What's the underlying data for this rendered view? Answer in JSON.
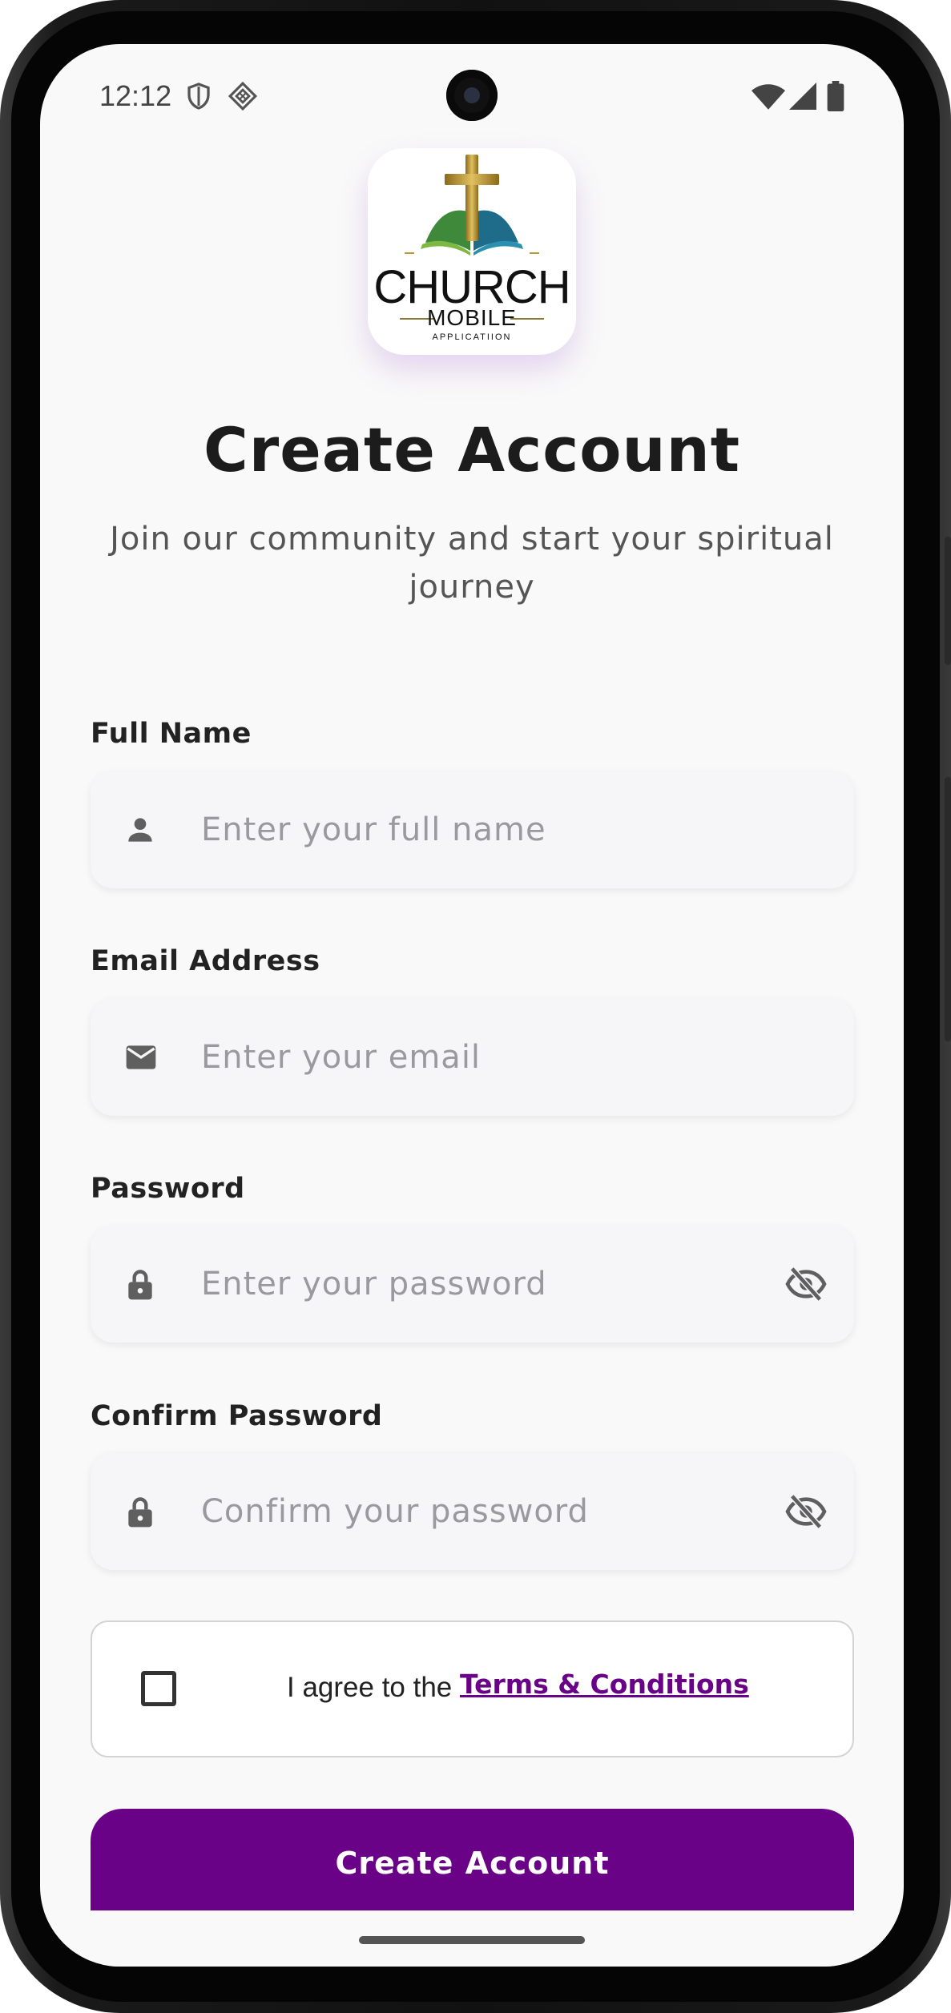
{
  "status_bar": {
    "time": "12:12"
  },
  "logo": {
    "word": "CHURCH",
    "sub": "MOBILE",
    "tag": "APPLICATIION"
  },
  "header": {
    "title": "Create Account",
    "subtitle": "Join our community and start your spiritual journey"
  },
  "form": {
    "full_name": {
      "label": "Full Name",
      "placeholder": "Enter your full name",
      "icon": "person-icon"
    },
    "email": {
      "label": "Email Address",
      "placeholder": "Enter your email",
      "icon": "mail-icon"
    },
    "password": {
      "label": "Password",
      "placeholder": "Enter your password",
      "icon": "lock-icon",
      "toggle_icon": "eye-off-icon"
    },
    "confirm_password": {
      "label": "Confirm Password",
      "placeholder": "Confirm your password",
      "icon": "lock-icon",
      "toggle_icon": "eye-off-icon"
    },
    "terms": {
      "prefix": "I agree to the ",
      "link": "Terms & Conditions",
      "checked": false
    },
    "submit_label": "Create Account"
  },
  "colors": {
    "accent": "#6a0288",
    "background": "#f9f9f9",
    "field_bg": "#f6f6f8",
    "icon": "#5f5f5f"
  }
}
